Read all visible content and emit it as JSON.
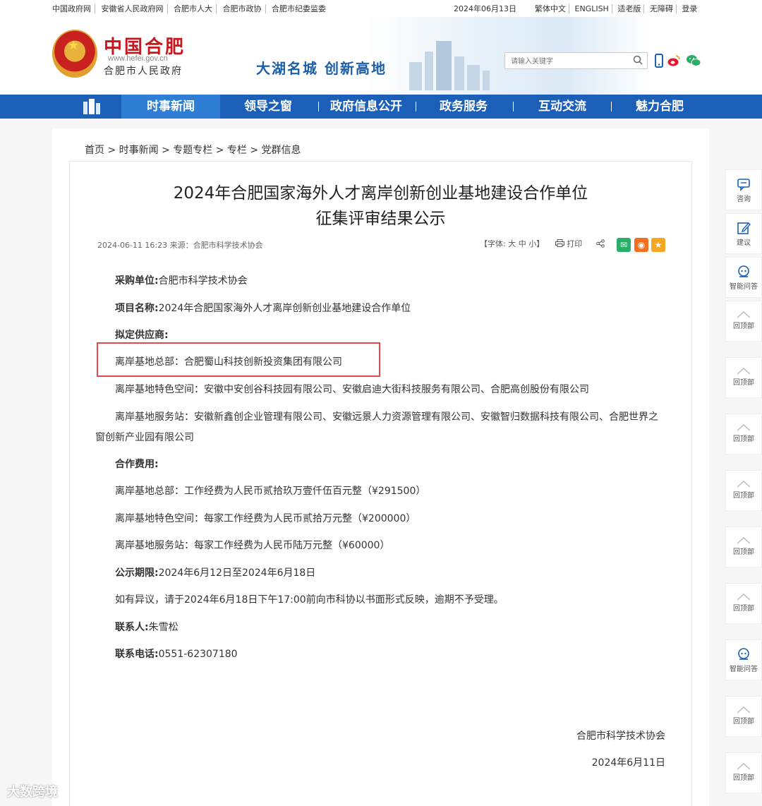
{
  "topbar": {
    "links": [
      "中国政府网",
      "安徽省人民政府网",
      "合肥市人大",
      "合肥市政协",
      "合肥市纪委监委"
    ],
    "date": "2024年06月13日",
    "options": [
      "繁体中文",
      "ENGLISH",
      "适老版",
      "无障碍",
      "登录"
    ]
  },
  "header": {
    "site_title": "中国合肥",
    "site_url": "www.hefei.gov.cn",
    "site_org": "合肥市人民政府",
    "slogan": "大湖名城  创新高地",
    "search_placeholder": "请输入关键字"
  },
  "nav": {
    "items": [
      "时事新闻",
      "领导之窗",
      "政府信息公开",
      "政务服务",
      "互动交流",
      "魅力合肥"
    ],
    "active_color": "#2e7ed6",
    "bar_color": "#1b5fb8"
  },
  "breadcrumb": "首页 > 时事新闻 > 专题专栏 > 专栏 > 党群信息",
  "article": {
    "title_line1": "2024年合肥国家海外人才离岸创新创业基地建设合作单位",
    "title_line2": "征集评审结果公示",
    "meta": "2024-06-11 16:23   来源：合肥市科学技术协会",
    "font_tool": "【字体:  大  中  小】",
    "print_label": "打印",
    "purchaser_label": "采购单位:",
    "purchaser_value": "合肥市科学技术协会",
    "project_label": "项目名称:",
    "project_value": "2024年合肥国家海外人才离岸创新创业基地建设合作单位",
    "supplier_label": "拟定供应商:",
    "hq_line": "离岸基地总部：合肥蜀山科技创新投资集团有限公司",
    "feature_line": "离岸基地特色空间：安徽中安创谷科技园有限公司、安徽启迪大街科技服务有限公司、合肥高创股份有限公司",
    "station_para": "离岸基地服务站：安徽新鑫创企业管理有限公司、安徽远景人力资源管理有限公司、安徽智归数据科技有限公司、合肥世界之窗创新产业园有限公司",
    "fee_label": "合作费用:",
    "fee_hq": "离岸基地总部：工作经费为人民币贰拾玖万壹仟伍百元整（¥291500）",
    "fee_feature": "离岸基地特色空间：每家工作经费为人民币贰拾万元整（¥200000）",
    "fee_station": "离岸基地服务站：每家工作经费为人民币陆万元整（¥60000）",
    "period_label": "公示期限:",
    "period_value": "2024年6月12日至2024年6月18日",
    "objection": "如有异议，请于2024年6月18日下午17:00前向市科协以书面形式反映，逾期不予受理。",
    "contact_label": "联系人:",
    "contact_value": "朱雪松",
    "phone_label": "联系电话:",
    "phone_value": "0551-62307180",
    "sign_org": "合肥市科学技术协会",
    "sign_date": "2024年6月11日",
    "highlight_color": "#e14a4a"
  },
  "sidebar": {
    "consult": "咨询",
    "suggest": "建议",
    "smart_qa": "智能问答",
    "back_top": "回顶部"
  },
  "watermark": "大数跨境"
}
